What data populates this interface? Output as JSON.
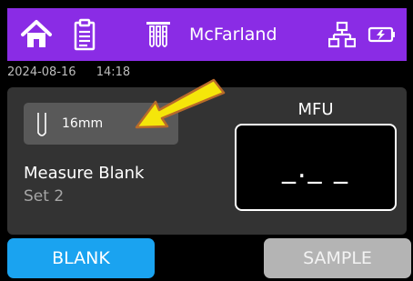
{
  "header": {
    "title": "McFarland",
    "icons": [
      "home-icon",
      "clipboard-icon",
      "tube-rack-icon",
      "network-icon",
      "battery-icon"
    ],
    "bar_color": "#8a2ce5"
  },
  "status": {
    "date": "2024-08-16",
    "time": "14:18"
  },
  "tube_selector": {
    "label": "16mm"
  },
  "measurement": {
    "title": "Measure Blank",
    "subtitle": "Set 2"
  },
  "reading": {
    "label": "MFU",
    "value": "_._ _"
  },
  "buttons": {
    "blank_label": "BLANK",
    "sample_label": "SAMPLE",
    "blank_color": "#1aa3f0",
    "sample_color": "#b4b4b4"
  },
  "annotation": {
    "arrow_color": "#f5e60a"
  }
}
